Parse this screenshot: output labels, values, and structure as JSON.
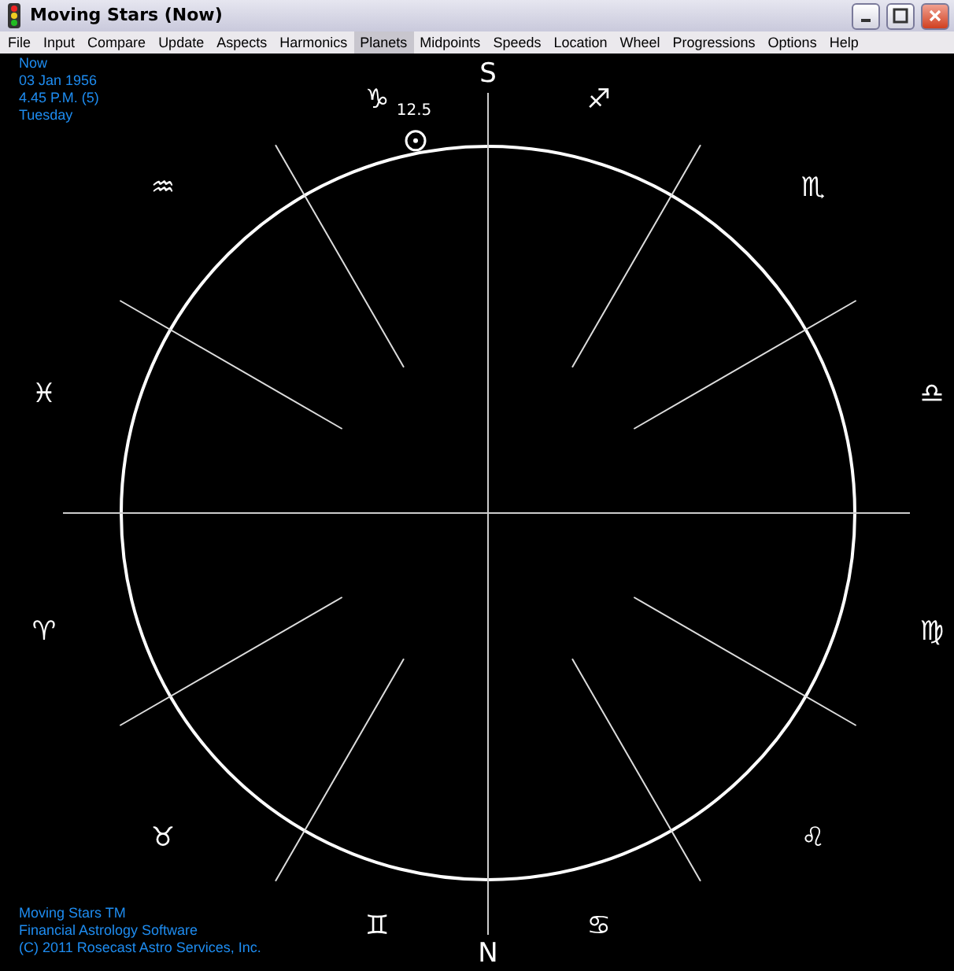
{
  "window": {
    "title": "Moving Stars (Now)"
  },
  "menu": [
    {
      "label": "File",
      "selected": false
    },
    {
      "label": "Input",
      "selected": false
    },
    {
      "label": "Compare",
      "selected": false
    },
    {
      "label": "Update",
      "selected": false
    },
    {
      "label": "Aspects",
      "selected": false
    },
    {
      "label": "Harmonics",
      "selected": false
    },
    {
      "label": "Planets",
      "selected": true
    },
    {
      "label": "Midpoints",
      "selected": false
    },
    {
      "label": "Speeds",
      "selected": false
    },
    {
      "label": "Location",
      "selected": false
    },
    {
      "label": "Wheel",
      "selected": false
    },
    {
      "label": "Progressions",
      "selected": false
    },
    {
      "label": "Options",
      "selected": false
    },
    {
      "label": "Help",
      "selected": false
    }
  ],
  "chart_info": [
    "Now",
    "03 Jan 1956",
    "4.45 P.M. (5)",
    "Tuesday"
  ],
  "wheel": {
    "top_label": "S",
    "bottom_label": "N",
    "signs": [
      "♈",
      "♉",
      "♊",
      "♋",
      "♌",
      "♍",
      "♎",
      "♏",
      "♐",
      "♑",
      "♒",
      "♓"
    ],
    "planets": [
      {
        "kind": "sun",
        "label": "12.5"
      }
    ]
  },
  "footer": [
    "Moving Stars TM",
    "Financial Astrology Software",
    "(C) 2011 Rosecast Astro Services, Inc."
  ]
}
